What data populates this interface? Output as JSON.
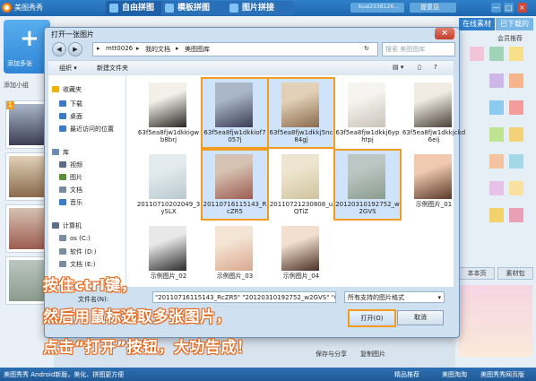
{
  "app": {
    "title": "美图秀秀",
    "tabs": [
      "自由拼图",
      "模板拼图",
      "图片拼接"
    ],
    "user_field": "kuai2158126...",
    "feedback": "提意见",
    "window_buttons": [
      "—",
      "□",
      "×"
    ]
  },
  "left_panel": {
    "add_big": "添加多张",
    "add_small": "添加小组"
  },
  "right_panel": {
    "tabs": [
      "在线素材",
      "已下载的"
    ],
    "sub_tab": "会员推荐",
    "buttons": [
      "本本页",
      "素材包"
    ]
  },
  "canvas": {
    "share_label": "保存与分享",
    "copy_label": "复制图片"
  },
  "status_bar": {
    "left": "美图秀秀 Android新版，美化、拼图更方便",
    "center": "精品推荐",
    "right_links": [
      "美图淘淘",
      "美图秀秀网页版"
    ]
  },
  "dialog": {
    "title": "打开一张图片",
    "close": "×",
    "breadcrumb": [
      "mtt0026",
      "我的文档",
      "美图图库"
    ],
    "search_placeholder": "搜索 美图图库",
    "toolbar": {
      "organize": "组织 ▾",
      "new_folder": "新建文件夹"
    },
    "nav": [
      {
        "label": "收藏夹",
        "icon": "star-icon",
        "color": "#f0b400"
      },
      {
        "label": "下载",
        "icon": "download-icon",
        "color": "#3c7cc5"
      },
      {
        "label": "桌面",
        "icon": "desktop-icon",
        "color": "#3c7cc5"
      },
      {
        "label": "最近访问的位置",
        "icon": "recent-icon",
        "color": "#3c7cc5"
      },
      {
        "label": "库",
        "icon": "library-icon",
        "color": "#6a8cb4"
      },
      {
        "label": "视频",
        "icon": "video-icon",
        "color": "#5c6e85"
      },
      {
        "label": "图片",
        "icon": "picture-icon",
        "color": "#5d8f3b"
      },
      {
        "label": "文档",
        "icon": "document-icon",
        "color": "#7a8ca0"
      },
      {
        "label": "音乐",
        "icon": "music-icon",
        "color": "#3c7cc5"
      },
      {
        "label": "计算机",
        "icon": "computer-icon",
        "color": "#5c6e85"
      },
      {
        "label": "os (C:)",
        "icon": "drive-icon",
        "color": "#7a8ca0"
      },
      {
        "label": "软件 (D:)",
        "icon": "drive-icon",
        "color": "#7a8ca0"
      },
      {
        "label": "文档 (E:)",
        "icon": "drive-icon",
        "color": "#7a8ca0"
      }
    ],
    "files": [
      {
        "name": "63f5ea8fjw1dkkigwb8brj",
        "selected": false,
        "colors": [
          "#f3efe9",
          "#2a2624"
        ]
      },
      {
        "name": "63f5ea8fjw1dkkiof7057j",
        "selected": true,
        "colors": [
          "#a9b7c9",
          "#3c3d55"
        ]
      },
      {
        "name": "63f5ea8fjw1dkkj5nc84gj",
        "selected": true,
        "colors": [
          "#e2d1b8",
          "#8a6a4c"
        ]
      },
      {
        "name": "63f5ea8fjw1dkkj6yphtpj",
        "selected": false,
        "colors": [
          "#f6f4f0",
          "#c8c2b8"
        ]
      },
      {
        "name": "63f5ea8fjw1dkkjckd6eij",
        "selected": false,
        "colors": [
          "#f0ece4",
          "#4a4038"
        ]
      },
      {
        "name": "20110710202049_3ySLX",
        "selected": false,
        "colors": [
          "#e4ebee",
          "#b8c9cf"
        ]
      },
      {
        "name": "20110716115143_RcZR5",
        "selected": true,
        "colors": [
          "#d6c2b2",
          "#9d5c51"
        ]
      },
      {
        "name": "20110721230808_uQTiZ",
        "selected": false,
        "colors": [
          "#ede5cf",
          "#d0c39e"
        ]
      },
      {
        "name": "20120310192752_w2GVS",
        "selected": true,
        "colors": [
          "#bcc6c2",
          "#8a9c8e"
        ]
      },
      {
        "name": "示例图片_01",
        "selected": false,
        "colors": [
          "#f0c9b0",
          "#5a3a2a"
        ]
      },
      {
        "name": "示例图片_02",
        "selected": false,
        "colors": [
          "#e8e8e8",
          "#2a2a2a"
        ]
      },
      {
        "name": "示例图片_03",
        "selected": false,
        "colors": [
          "#f4e4d4",
          "#d9a890"
        ]
      },
      {
        "name": "示例图片_04",
        "selected": false,
        "colors": [
          "#f2dfd0",
          "#4a2f22"
        ]
      }
    ],
    "filename_label": "文件名(N):",
    "filename_value": "\"20110716115143_RcZR5\" \"20120310192752_w2GVS\" \"63f",
    "filter_value": "所有支持的图片格式",
    "open_button": "打开(O)",
    "cancel_button": "取消"
  },
  "overlay": {
    "line1": "按住ctrl键，",
    "line2": "然后用鼠标选取多张图片，",
    "line3": "点击“打开”按钮，大功告成！"
  },
  "colors": {
    "accent": "#f19c1e",
    "brand": "#2e7fcb"
  }
}
